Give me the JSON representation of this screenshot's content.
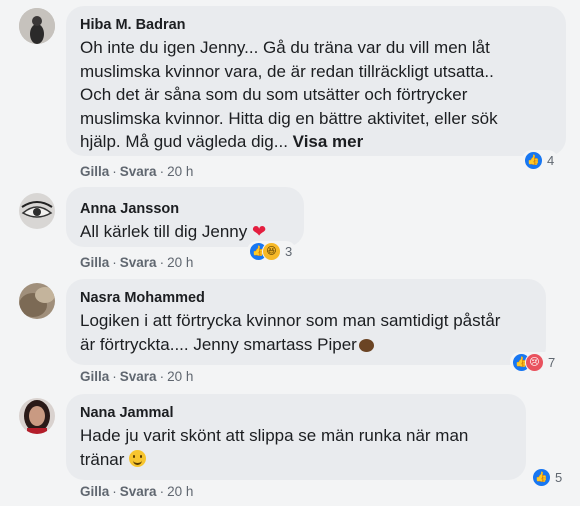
{
  "comments": [
    {
      "author": "Hiba M. Badran",
      "text": "Oh inte du igen Jenny... Gå du träna var du vill men låt\nmuslimska kvinnor vara, de är redan tillräckligt utsatta..\nOch det är såna som du som utsätter och förtrycker\nmuslimska kvinnor. Hitta dig en bättre aktivitet, eller sök\nhjälp. Må gud vägleda dig...",
      "see_more": "Visa mer",
      "like": "Gilla",
      "reply": "Svara",
      "time": "20 h",
      "reaction_count": "4",
      "reactions": [
        "like-icon"
      ]
    },
    {
      "author": "Anna Jansson",
      "text": "All kärlek till dig Jenny",
      "text_emoji": "heart-emoji",
      "like": "Gilla",
      "reply": "Svara",
      "time": "20 h",
      "reaction_count": "3",
      "reactions": [
        "like-icon",
        "haha-icon"
      ]
    },
    {
      "author": "Nasra Mohammed",
      "text": "Logiken i att förtrycka kvinnor som man samtidigt påstår\när förtryckta.... Jenny smartass Piper",
      "text_emoji": "brownie-emoji",
      "like": "Gilla",
      "reply": "Svara",
      "time": "20 h",
      "reaction_count": "7",
      "reactions": [
        "like-icon",
        "sad-icon"
      ]
    },
    {
      "author": "Nana Jammal",
      "text": "Hade ju varit skönt att slippa se män runka när man\ntränar",
      "text_emoji": "smile-emoji",
      "like": "Gilla",
      "reply": "Svara",
      "time": "20 h",
      "reaction_count": "5",
      "reactions": [
        "like-icon"
      ]
    }
  ],
  "colors": {
    "like": "#1877f2",
    "haha": "#f7b928",
    "sad": "#e9525e",
    "bubble": "#e9ebee"
  }
}
